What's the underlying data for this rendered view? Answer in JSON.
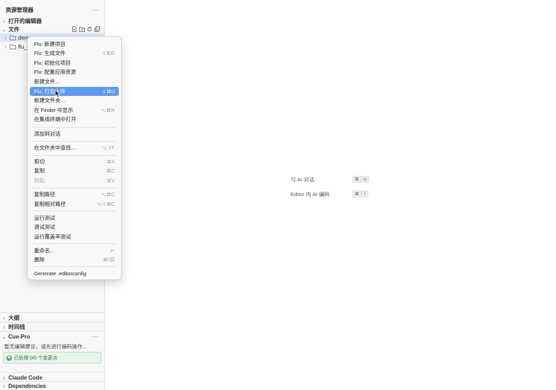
{
  "sidebar": {
    "title": "资源管理器",
    "more": "···",
    "sections": {
      "open_editors": "打开的编辑器",
      "files": "文件",
      "outline": "大纲",
      "timeline": "时间线",
      "cue_pro": "Cue-Pro",
      "claude_code": "Claude Code",
      "dependencies": "Dependencies"
    },
    "tree": [
      "demo",
      "flu_c"
    ],
    "cue": {
      "description": "暂无编辑建议，请先进行编码操作...",
      "badge": "已处理 0/0 个变更点",
      "more": "···"
    }
  },
  "menu": {
    "items": [
      {
        "label": "Flu: 新建项目",
        "shortcut": ""
      },
      {
        "label": "Flu: 生成文件",
        "shortcut": "⇧⌘G"
      },
      {
        "label": "Flu: 初始化项目",
        "shortcut": ""
      },
      {
        "label": "Flu: 配置应用资源",
        "shortcut": ""
      },
      {
        "label": "新建文件...",
        "shortcut": ""
      },
      {
        "label": "Flu: 打包上传",
        "shortcut": "⇧⌘U"
      },
      {
        "label": "新建文件夹...",
        "shortcut": ""
      },
      {
        "label": "在 Finder 中显示",
        "shortcut": "⌥⌘R"
      },
      {
        "label": "在集成终端中打开",
        "shortcut": ""
      },
      {
        "label": "添加到对话",
        "shortcut": ""
      },
      {
        "label": "在文件夹中查找...",
        "shortcut": "⌥⇧F"
      },
      {
        "label": "剪切",
        "shortcut": "⌘X"
      },
      {
        "label": "复制",
        "shortcut": "⌘C"
      },
      {
        "label": "粘贴",
        "shortcut": "⌘V"
      },
      {
        "label": "复制路径",
        "shortcut": "⌥⌘C"
      },
      {
        "label": "复制相对路径",
        "shortcut": "⌥⇧⌘C"
      },
      {
        "label": "运行测试",
        "shortcut": ""
      },
      {
        "label": "调试测试",
        "shortcut": ""
      },
      {
        "label": "运行覆盖率测试",
        "shortcut": ""
      },
      {
        "label": "重命名...",
        "shortcut": "↵"
      },
      {
        "label": "删除",
        "shortcut": "⌘⌫"
      },
      {
        "label": "Generate .editorconfig",
        "shortcut": ""
      }
    ],
    "highlighted": "Flu: 打包上传",
    "disabled": "粘贴"
  },
  "main": {
    "hints": [
      {
        "label": "与 AI 对话",
        "keys": [
          "⌘",
          "U"
        ]
      },
      {
        "label": "Editor 内 AI 编码",
        "keys": [
          "⌘",
          "I"
        ]
      }
    ]
  },
  "colors": {
    "highlight": "#5b9bf5",
    "badge_bg": "#e6f4ea",
    "badge_text": "#2f6e3b"
  }
}
